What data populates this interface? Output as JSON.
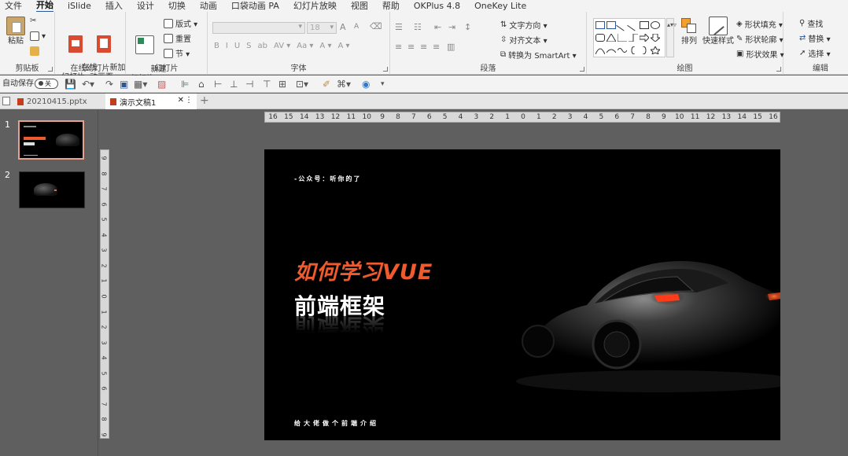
{
  "menu": {
    "tabs": [
      "文件",
      "开始",
      "iSlide",
      "插入",
      "设计",
      "切换",
      "动画",
      "口袋动画 PA",
      "幻灯片放映",
      "视图",
      "帮助",
      "OKPlus 4.8",
      "OneKey Lite"
    ],
    "active": "开始"
  },
  "ribbon": {
    "clipboard": {
      "label": "剪贴板",
      "paste": "粘贴"
    },
    "online_slides": {
      "label": "在线幻灯片",
      "online": "在线\n幻灯片 ▾",
      "new_anim": "新加\n动画页 ▾"
    },
    "slides": {
      "label": "幻灯片",
      "new_slide": "新建\n幻灯片 ▾",
      "layout": "版式 ▾",
      "reset": "重置",
      "section": "节 ▾"
    },
    "font": {
      "label": "字体",
      "size": "18",
      "buttons": [
        "B",
        "I",
        "U",
        "S",
        "ab",
        "AV ▾",
        "Aa ▾",
        "A ▾",
        "A ▾"
      ]
    },
    "paragraph": {
      "label": "段落",
      "text_direction": "文字方向 ▾",
      "align_text": "对齐文本 ▾",
      "smartart": "转换为 SmartArt ▾"
    },
    "drawing": {
      "label": "绘图",
      "arrange": "排列",
      "quick_styles": "快速样式",
      "shape_fill": "形状填充 ▾",
      "shape_outline": "形状轮廓 ▾",
      "shape_effects": "形状效果 ▾"
    },
    "editing": {
      "label": "编辑",
      "find": "查找",
      "replace": "替换 ▾",
      "select": "选择 ▾"
    }
  },
  "qat": {
    "autosave": "自动保存",
    "toggle": "关"
  },
  "doc_tabs": [
    {
      "name": "20210415.pptx",
      "active": false
    },
    {
      "name": "演示文稿1",
      "active": true
    }
  ],
  "thumbnails": [
    {
      "number": "1",
      "selected": true
    },
    {
      "number": "2",
      "selected": false
    }
  ],
  "ruler": {
    "horizontal": [
      "16",
      "15",
      "14",
      "13",
      "12",
      "11",
      "10",
      "9",
      "8",
      "7",
      "6",
      "5",
      "4",
      "3",
      "2",
      "1",
      "0",
      "1",
      "2",
      "3",
      "4",
      "5",
      "6",
      "7",
      "8",
      "9",
      "10",
      "11",
      "12",
      "13",
      "14",
      "15",
      "16"
    ],
    "vertical": [
      "9",
      "8",
      "7",
      "6",
      "5",
      "4",
      "3",
      "2",
      "1",
      "0",
      "1",
      "2",
      "3",
      "4",
      "5",
      "6",
      "7",
      "8",
      "9"
    ]
  },
  "slide": {
    "subtitle": "-公众号：听你的了",
    "title": "如何学习VUE",
    "subhead": "前端框架",
    "footer": "给大佬做个前端介绍",
    "title_color": "#ef5b2f"
  }
}
